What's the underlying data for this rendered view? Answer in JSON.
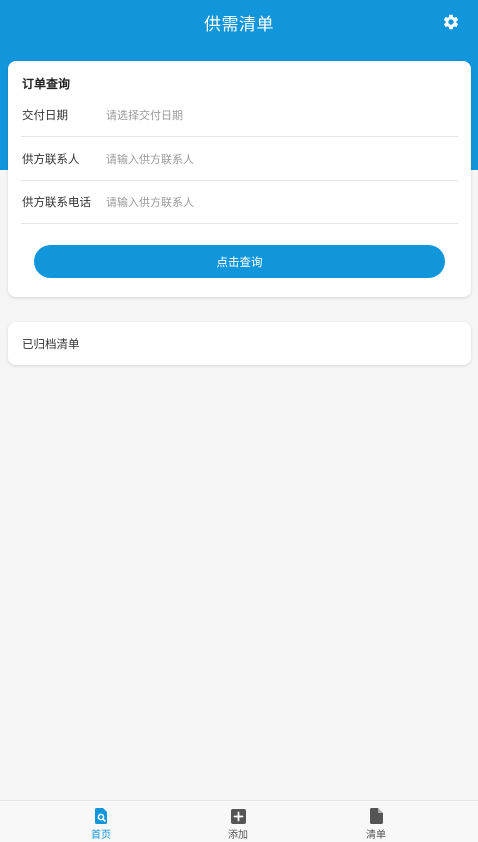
{
  "header": {
    "title": "供需清单",
    "settings_icon": "gear-icon"
  },
  "colors": {
    "primary": "#1296db",
    "background": "#f5f5f5",
    "card": "#ffffff"
  },
  "query": {
    "title": "订单查询",
    "fields": [
      {
        "label": "交付日期",
        "placeholder": "请选择交付日期",
        "value": ""
      },
      {
        "label": "供方联系人",
        "placeholder": "请输入供方联系人",
        "value": ""
      },
      {
        "label": "供方联系电话",
        "placeholder": "请输入供方联系人",
        "value": ""
      }
    ],
    "button_label": "点击查询"
  },
  "archive": {
    "label": "已归档清单"
  },
  "tabbar": {
    "items": [
      {
        "label": "首页",
        "icon": "search-document-icon",
        "active": true
      },
      {
        "label": "添加",
        "icon": "plus-square-icon",
        "active": false
      },
      {
        "label": "清单",
        "icon": "document-icon",
        "active": false
      }
    ]
  }
}
